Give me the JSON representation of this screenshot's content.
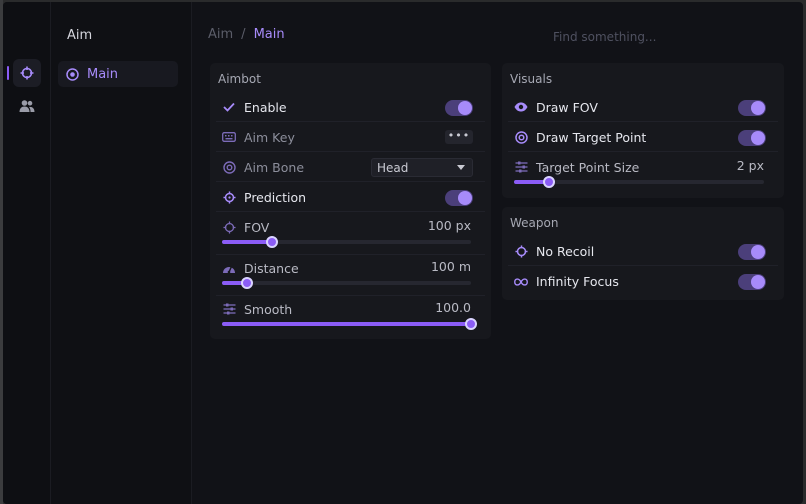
{
  "breadcrumb": {
    "parent": "Aim",
    "separator": "/",
    "current": "Main"
  },
  "search": {
    "placeholder": "Find something..."
  },
  "rail": {
    "items": [
      {
        "icon": "crosshair-icon",
        "active": true
      },
      {
        "icon": "users-icon",
        "active": false
      }
    ]
  },
  "sub_sidebar": {
    "title": "Aim",
    "items": [
      {
        "label": "Main",
        "icon": "target-icon",
        "active": true
      }
    ]
  },
  "aimbot": {
    "title": "Aimbot",
    "enable": {
      "label": "Enable",
      "on": true
    },
    "aim_key": {
      "label": "Aim Key",
      "button": "•••"
    },
    "aim_bone": {
      "label": "Aim Bone",
      "value": "Head"
    },
    "prediction": {
      "label": "Prediction",
      "on": true
    },
    "fov": {
      "label": "FOV",
      "value": "100 px",
      "fraction": 0.2
    },
    "distance": {
      "label": "Distance",
      "value": "100 m",
      "fraction": 0.1
    },
    "smooth": {
      "label": "Smooth",
      "value": "100.0",
      "fraction": 1.0
    }
  },
  "visuals": {
    "title": "Visuals",
    "draw_fov": {
      "label": "Draw FOV",
      "on": true
    },
    "draw_target_point": {
      "label": "Draw Target Point",
      "on": true
    },
    "target_point_size": {
      "label": "Target Point Size",
      "value": "2 px",
      "fraction": 0.14
    }
  },
  "weapon": {
    "title": "Weapon",
    "no_recoil": {
      "label": "No Recoil",
      "on": true
    },
    "infinity_focus": {
      "label": "Infinity Focus",
      "on": true
    }
  },
  "colors": {
    "accent": "#8b5cf6",
    "accent_light": "#a78bfa",
    "background": "#111217",
    "panel": "#17181d"
  }
}
